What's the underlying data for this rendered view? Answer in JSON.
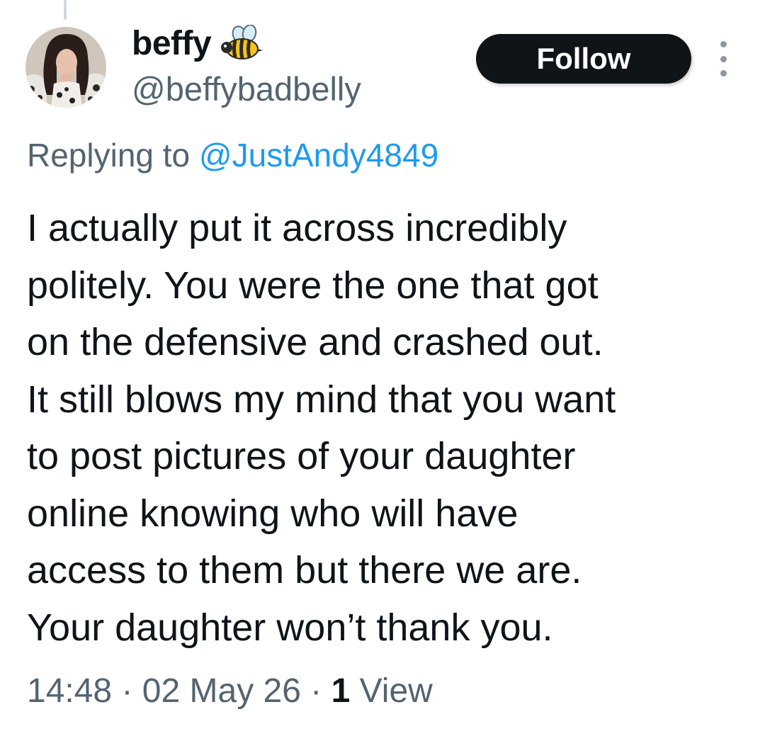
{
  "author": {
    "display_name": "beffy",
    "badge_emoji": "bee-icon",
    "handle": "@beffybadbelly"
  },
  "actions": {
    "follow_label": "Follow",
    "more_icon": "more-vertical-icon"
  },
  "reply": {
    "prefix": "Replying to",
    "target": "@JustAndy4849"
  },
  "tweet": {
    "lines": [
      "I actually put it across incredibly",
      "politely. You were the one that got",
      "on the defensive and crashed out.",
      "It still blows my mind that you want",
      "to post pictures of your daughter",
      "online knowing who will have",
      "access to them but there we are.",
      "Your daughter won’t thank you."
    ]
  },
  "meta": {
    "time": "14:48",
    "separator": "·",
    "date": "02 May 26",
    "views_count": "1",
    "views_label": "View"
  },
  "colors": {
    "text_primary": "#0f1419",
    "text_secondary": "#536471",
    "link": "#1d9bf0",
    "button_bg": "#0f1419",
    "button_text": "#ffffff"
  }
}
